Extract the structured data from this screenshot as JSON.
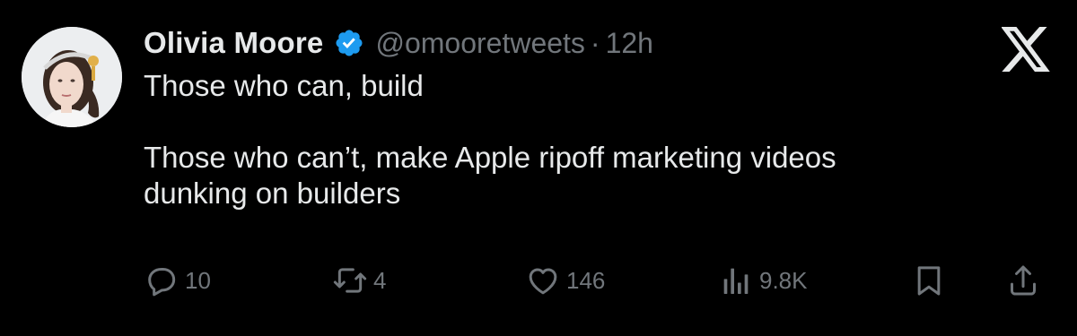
{
  "post": {
    "author": {
      "display_name": "Olivia Moore",
      "handle": "@omooretweets",
      "verified": true
    },
    "separator": "·",
    "time": "12h",
    "text_lines": [
      "Those who can, build",
      "Those who can’t, make Apple ripoff marketing videos",
      "dunking on builders"
    ],
    "actions": {
      "replies": "10",
      "reposts": "4",
      "likes": "146",
      "views": "9.8K"
    }
  },
  "colors": {
    "background": "#000000",
    "text": "#e7e9ea",
    "secondary": "#71767b",
    "verified_badge": "#1d9bf0"
  },
  "icons": [
    "x-logo-icon",
    "verified-badge-icon",
    "reply-icon",
    "repost-icon",
    "like-icon",
    "views-icon",
    "bookmark-icon",
    "share-icon"
  ]
}
